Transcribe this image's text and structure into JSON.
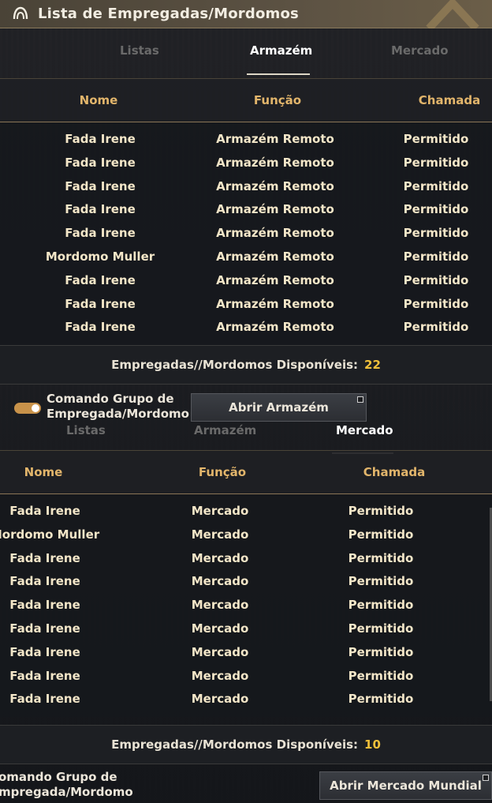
{
  "title": "Lista de Empregadas/Mordomos",
  "columns": {
    "name": "Nome",
    "function": "Função",
    "call": "Chamada"
  },
  "tabs": [
    "Listas",
    "Armazém",
    "Mercado"
  ],
  "warehouse": {
    "active_tab": "Armazém",
    "rows": [
      [
        "Fada Irene",
        "Armazém Remoto",
        "Permitido"
      ],
      [
        "Fada Irene",
        "Armazém Remoto",
        "Permitido"
      ],
      [
        "Fada Irene",
        "Armazém Remoto",
        "Permitido"
      ],
      [
        "Fada Irene",
        "Armazém Remoto",
        "Permitido"
      ],
      [
        "Fada Irene",
        "Armazém Remoto",
        "Permitido"
      ],
      [
        "Mordomo Muller",
        "Armazém Remoto",
        "Permitido"
      ],
      [
        "Fada Irene",
        "Armazém Remoto",
        "Permitido"
      ],
      [
        "Fada Irene",
        "Armazém Remoto",
        "Permitido"
      ],
      [
        "Fada Irene",
        "Armazém Remoto",
        "Permitido"
      ]
    ],
    "available_label": "Empregadas//Mordomos Disponíveis:",
    "available_count": "22",
    "group_command_line1": "Comando Grupo de",
    "group_command_line2": "Empregada/Mordomo",
    "open_button": "Abrir Armazém"
  },
  "market": {
    "active_tab": "Mercado",
    "rows": [
      [
        "Fada Irene",
        "Mercado",
        "Permitido"
      ],
      [
        "Mordomo Muller",
        "Mercado",
        "Permitido"
      ],
      [
        "Fada Irene",
        "Mercado",
        "Permitido"
      ],
      [
        "Fada Irene",
        "Mercado",
        "Permitido"
      ],
      [
        "Fada Irene",
        "Mercado",
        "Permitido"
      ],
      [
        "Fada Irene",
        "Mercado",
        "Permitido"
      ],
      [
        "Fada Irene",
        "Mercado",
        "Permitido"
      ],
      [
        "Fada Irene",
        "Mercado",
        "Permitido"
      ],
      [
        "Fada Irene",
        "Mercado",
        "Permitido"
      ]
    ],
    "available_label": "Empregadas//Mordomos Disponíveis:",
    "available_count": "10",
    "group_command_line1": "omando Grupo de",
    "group_command_line2": "mpregada/Mordomo",
    "open_button": "Abrir Mercado Mundial"
  },
  "colors": {
    "accent": "#e2b56b",
    "count": "#f0c03a",
    "toggle": "#c8924a"
  }
}
